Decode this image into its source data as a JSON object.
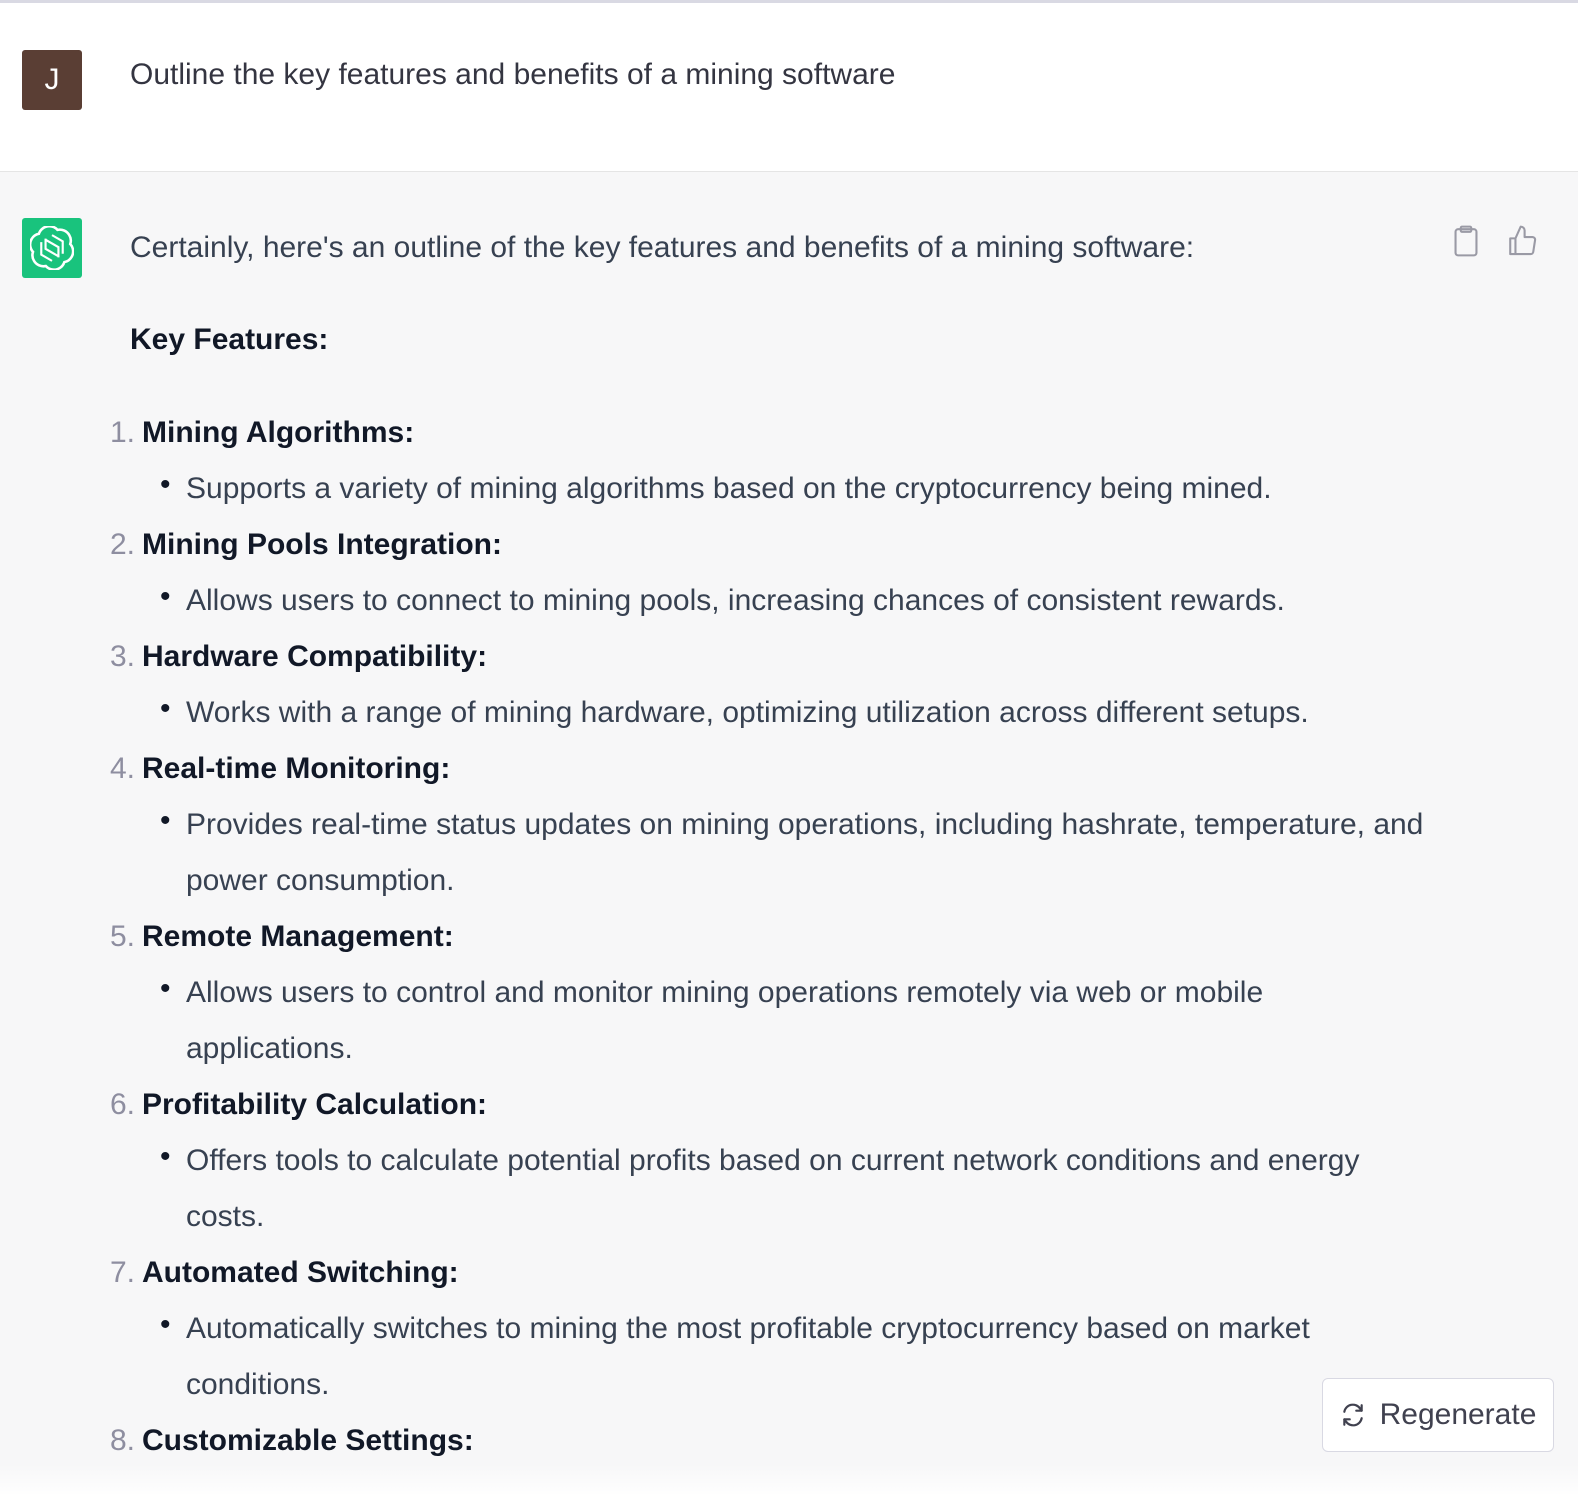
{
  "user": {
    "avatar_letter": "J",
    "message": "Outline the key features and benefits of a mining software"
  },
  "assistant": {
    "intro": "Certainly, here's an outline of the key features and benefits of a mining software:",
    "heading": "Key Features:",
    "features": [
      {
        "num": "1.",
        "title": "Mining Algorithms:",
        "desc": "Supports a variety of mining algorithms based on the cryptocurrency being mined."
      },
      {
        "num": "2.",
        "title": "Mining Pools Integration:",
        "desc": "Allows users to connect to mining pools, increasing chances of consistent rewards."
      },
      {
        "num": "3.",
        "title": "Hardware Compatibility:",
        "desc": "Works with a range of mining hardware, optimizing utilization across different setups."
      },
      {
        "num": "4.",
        "title": "Real-time Monitoring:",
        "desc": "Provides real-time status updates on mining operations, including hashrate, temperature, and power consumption."
      },
      {
        "num": "5.",
        "title": "Remote Management:",
        "desc": "Allows users to control and monitor mining operations remotely via web or mobile applications."
      },
      {
        "num": "6.",
        "title": "Profitability Calculation:",
        "desc": "Offers tools to calculate potential profits based on current network conditions and energy costs."
      },
      {
        "num": "7.",
        "title": "Automated Switching:",
        "desc": "Automatically switches to mining the most profitable cryptocurrency based on market conditions."
      },
      {
        "num": "8.",
        "title": "Customizable Settings:",
        "desc": ""
      }
    ],
    "icons": [
      "clipboard-icon",
      "thumbs-up-icon",
      "thumbs-down-icon"
    ]
  },
  "regenerate": {
    "label": "Regenerate",
    "icon": "refresh-icon"
  },
  "colors": {
    "user_avatar_bg": "#5a3e34",
    "assistant_avatar_bg": "#19c37d",
    "assistant_row_bg": "#f7f7f8"
  }
}
